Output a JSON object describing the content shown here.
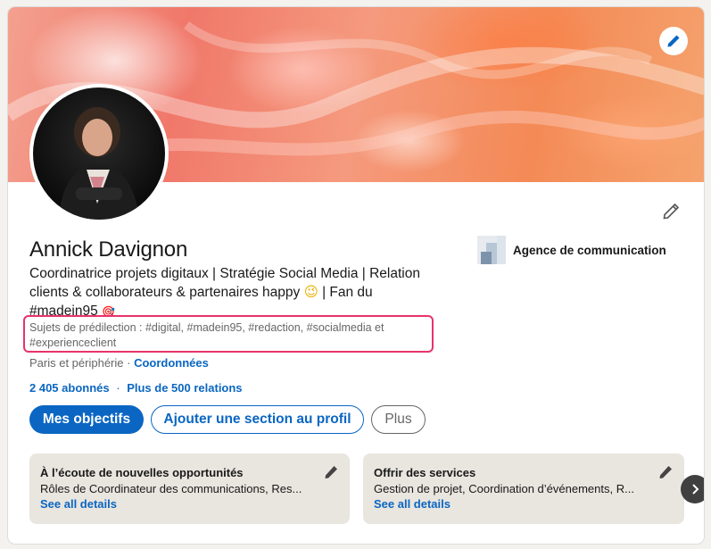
{
  "profile": {
    "name": "Annick Davignon",
    "headline_line1": "Coordinatrice projets digitaux | Stratégie Social Media | Relation",
    "headline_line2": "clients & collaborateurs & partenaires happy ",
    "headline_emoji": "😉",
    "headline_line2_end": " | Fan du",
    "headline_line3": "#madein95 ",
    "headline_icon": "🎯",
    "topics_line1": "Sujets de prédilection : #digital, #madein95, #redaction, #socialmedia et",
    "topics_line2": "#experienceclient",
    "location": "Paris et périphérie",
    "location_separator": " · ",
    "contact_link": "Coordonnées",
    "followers": "2 405 abonnés",
    "stats_separator": "·",
    "connections": "Plus de 500 relations"
  },
  "company": {
    "name": "Agence de communication"
  },
  "actions": {
    "primary": "Mes objectifs",
    "secondary": "Ajouter une section au profil",
    "more": "Plus"
  },
  "cards": [
    {
      "title": "À l’écoute de nouvelles opportunités",
      "description": "Rôles de Coordinateur des communications, Res...",
      "link": "See all details"
    },
    {
      "title": "Offrir des services",
      "description": "Gestion de projet, Coordination d’événements, R...",
      "link": "See all details"
    }
  ],
  "colors": {
    "linkedin_blue": "#0a66c2",
    "highlight": "#e8336b",
    "card_bg": "#e9e5df"
  },
  "icons": {
    "banner_edit": "pencil-icon",
    "profile_edit": "pencil-icon",
    "card_edit": "pencil-icon",
    "carousel_next": "chevron-right-icon"
  }
}
